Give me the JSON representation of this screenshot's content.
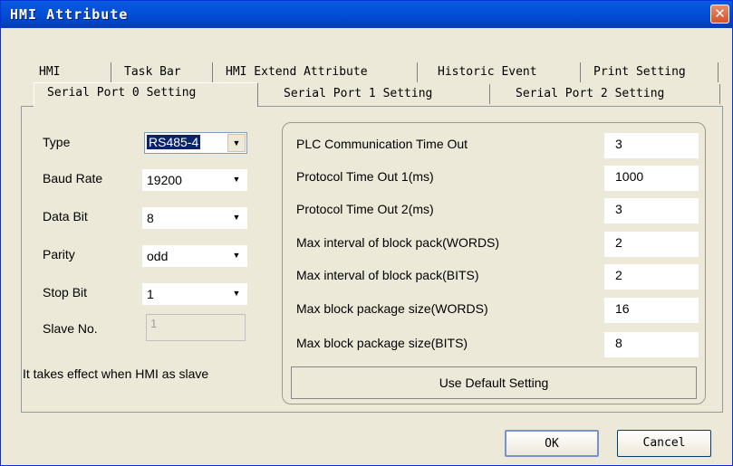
{
  "window": {
    "title": "HMI Attribute",
    "close_label": "✕"
  },
  "tabs_row1": [
    {
      "label": "HMI"
    },
    {
      "label": "Task Bar"
    },
    {
      "label": "HMI Extend Attribute"
    },
    {
      "label": "Historic Event"
    },
    {
      "label": "Print Setting"
    }
  ],
  "tabs_row2": [
    {
      "label": "Serial Port 0 Setting",
      "active": true
    },
    {
      "label": "Serial Port 1 Setting"
    },
    {
      "label": "Serial Port 2 Setting"
    }
  ],
  "port": {
    "type_label": "Type",
    "type_value": "RS485-4",
    "baud_label": "Baud Rate",
    "baud_value": "19200",
    "databit_label": "Data Bit",
    "databit_value": "8",
    "parity_label": "Parity",
    "parity_value": "odd",
    "stopbit_label": "Stop Bit",
    "stopbit_value": "1",
    "slave_label": "Slave No.",
    "slave_value": "1",
    "note": "It takes effect when HMI as slave"
  },
  "params": [
    {
      "label": "PLC Communication Time Out",
      "value": "3"
    },
    {
      "label": "Protocol Time Out 1(ms)",
      "value": "1000"
    },
    {
      "label": "Protocol Time Out 2(ms)",
      "value": "3"
    },
    {
      "label": "Max interval of block pack(WORDS)",
      "value": "2"
    },
    {
      "label": "Max interval of block pack(BITS)",
      "value": "2"
    },
    {
      "label": "Max block package size(WORDS)",
      "value": "16"
    },
    {
      "label": "Max block package size(BITS)",
      "value": "8"
    }
  ],
  "buttons": {
    "default_setting": "Use Default Setting",
    "ok": "OK",
    "cancel": "Cancel"
  },
  "colors": {
    "titlebar": "#0054e3",
    "selection": "#0a246a",
    "close": "#d5532c"
  }
}
